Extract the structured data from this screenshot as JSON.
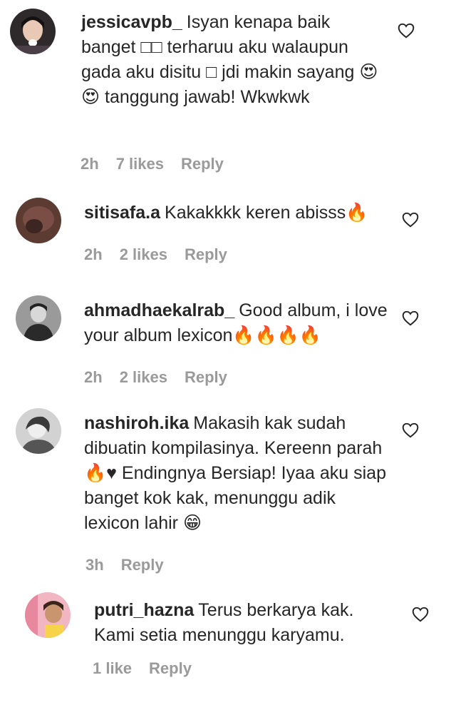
{
  "comments": [
    {
      "username": "jessicavpb_",
      "text": "Isyan kenapa baik banget □□ terharuu aku walaupun gada aku disitu □ jdi makin sayang 😍😍 tanggung jawab! Wkwkwk",
      "time": "2h",
      "likes": "7 likes",
      "reply": "Reply",
      "avatar_icon": "user-avatar-girl"
    },
    {
      "username": "sitisafa.a",
      "text": "Kakakkkk keren abisss🔥",
      "time": "2h",
      "likes": "2 likes",
      "reply": "Reply",
      "avatar_icon": "user-avatar-dark"
    },
    {
      "username": "ahmadhaekalrab_",
      "text": "Good album, i love your album lexicon🔥🔥🔥🔥",
      "time": "2h",
      "likes": "2 likes",
      "reply": "Reply",
      "avatar_icon": "user-avatar-boy"
    },
    {
      "username": "nashiroh.ika",
      "text": "Makasih kak sudah dibuatin kompilasinya. Kereenn parah 🔥♥ Endingnya Bersiap! Iyaa aku siap banget kok kak, menunggu adik lexicon lahir 😁",
      "time": "3h",
      "reply": "Reply",
      "avatar_icon": "user-avatar-bw"
    },
    {
      "username": "putri_hazna",
      "text": "Terus berkarya kak. Kami setia menunggu karyamu.",
      "likes": "1 like",
      "reply": "Reply",
      "avatar_icon": "user-avatar-pink"
    }
  ],
  "colors": {
    "text": "#262626",
    "meta": "#9a9a9a",
    "background": "#ffffff"
  },
  "icons": {
    "like": "heart-outline-icon"
  }
}
